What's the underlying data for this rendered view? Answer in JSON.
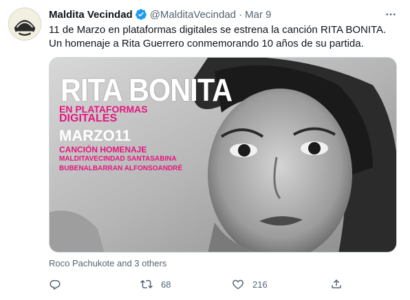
{
  "tweet": {
    "display_name": "Maldita Vecindad",
    "handle": "@MalditaVecindad",
    "separator": "·",
    "time": "Mar 9",
    "text_line1": "11 de Marzo en plataformas digitales se estrena la canción RITA BONITA.",
    "text_line2": "Un homenaje a Rita Guerrero conmemorando 10 años de su partida.",
    "liked_by": "Roco Pachukote and 3 others"
  },
  "media": {
    "title": "RITA BONITA",
    "line1": "EN PLATAFORMAS",
    "line2": "DIGITALES",
    "date": "MARZO11",
    "line4": "CANCIÓN HOMENAJE",
    "line5": "MALDITAVECINDAD SANTASABINA",
    "line6": "BUBENALBARRAN ALFONSOANDRÉ"
  },
  "actions": {
    "reply_count": "",
    "retweet_count": "68",
    "like_count": "216"
  },
  "icons": {
    "verified": "verified-badge-icon",
    "more": "more-icon",
    "reply": "reply-icon",
    "retweet": "retweet-icon",
    "like": "like-icon",
    "share": "share-icon"
  },
  "colors": {
    "verified": "#1d9bf0",
    "secondary_text": "#536471",
    "poster_pink": "#e4157f"
  }
}
